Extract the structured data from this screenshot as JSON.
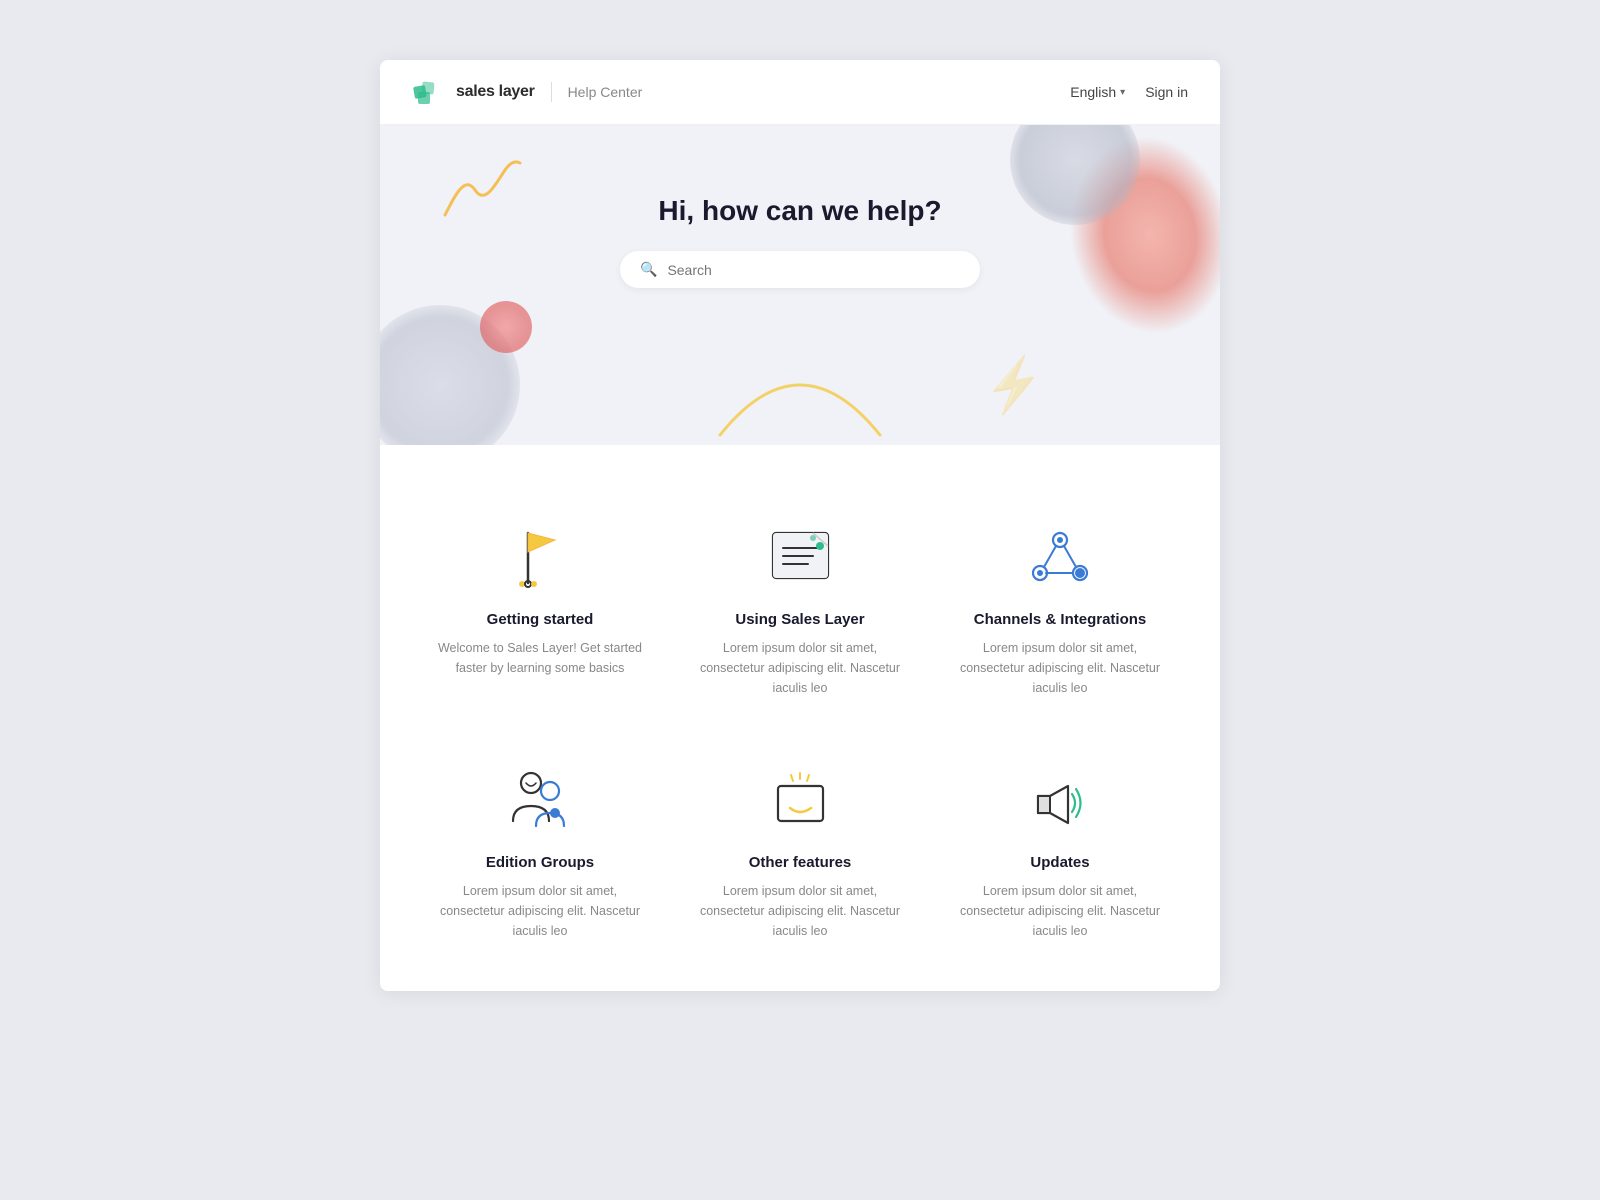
{
  "header": {
    "logo_text": "sales layer",
    "divider": "|",
    "help_center": "Help Center",
    "lang_label": "English",
    "sign_in_label": "Sign in"
  },
  "hero": {
    "title": "Hi, how can we help?",
    "search_placeholder": "Search"
  },
  "categories": [
    {
      "id": "getting-started",
      "title": "Getting started",
      "description": "Welcome to Sales Layer! Get started faster by learning some basics",
      "icon": "flag"
    },
    {
      "id": "using-sales-layer",
      "title": "Using Sales Layer",
      "description": "Lorem ipsum dolor sit amet, consectetur adipiscing elit. Nascetur iaculis leo",
      "icon": "document"
    },
    {
      "id": "channels-integrations",
      "title": "Channels & Integrations",
      "description": "Lorem ipsum dolor sit amet, consectetur adipiscing elit. Nascetur iaculis leo",
      "icon": "network"
    },
    {
      "id": "edition-groups",
      "title": "Edition Groups",
      "description": "Lorem ipsum dolor sit amet, consectetur adipiscing elit. Nascetur iaculis leo",
      "icon": "person"
    },
    {
      "id": "other-features",
      "title": "Other features",
      "description": "Lorem ipsum dolor sit amet, consectetur adipiscing elit. Nascetur iaculis leo",
      "icon": "box"
    },
    {
      "id": "updates",
      "title": "Updates",
      "description": "Lorem ipsum dolor sit amet, consectetur adipiscing elit. Nascetur iaculis leo",
      "icon": "megaphone"
    }
  ]
}
